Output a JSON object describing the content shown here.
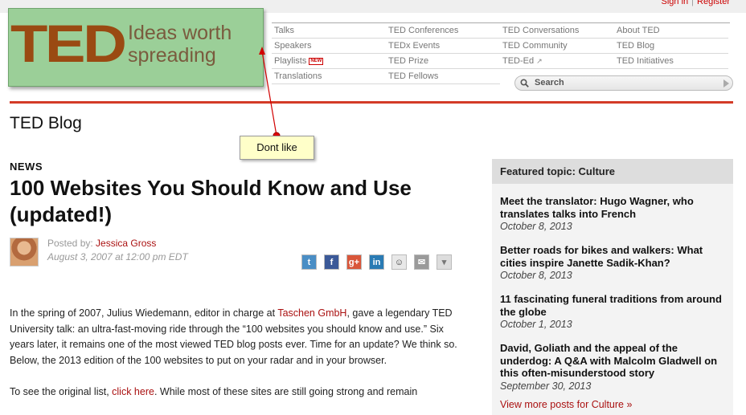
{
  "auth": {
    "sign_in": "Sign in",
    "register": "Register"
  },
  "logo": {
    "wordmark": "TED",
    "tagline_line1": "Ideas worth",
    "tagline_line2": "spreading"
  },
  "nav": {
    "columns": [
      [
        {
          "label": "Talks"
        },
        {
          "label": "Speakers"
        },
        {
          "label": "Playlists",
          "badge": "NEW"
        },
        {
          "label": "Translations"
        }
      ],
      [
        {
          "label": "TED Conferences"
        },
        {
          "label": "TEDx Events"
        },
        {
          "label": "TED Prize"
        },
        {
          "label": "TED Fellows"
        }
      ],
      [
        {
          "label": "TED Conversations"
        },
        {
          "label": "TED Community"
        },
        {
          "label": "TED-Ed"
        }
      ],
      [
        {
          "label": "About TED"
        },
        {
          "label": "TED Blog"
        },
        {
          "label": "TED Initiatives"
        }
      ]
    ]
  },
  "search": {
    "label": "Search"
  },
  "blog_title": "TED Blog",
  "note": {
    "text": "Dont like"
  },
  "article": {
    "category": "NEWS",
    "headline": "100 Websites You Should Know and Use (updated!)",
    "posted_by_prefix": "Posted by:",
    "author": "Jessica Gross",
    "date": "August 3, 2007 at 12:00 pm EDT",
    "p1_a": "In the spring of 2007, Julius Wiedemann, editor in charge at ",
    "p1_link": "Taschen GmbH",
    "p1_b": ", gave a legendary TED University talk: an ultra-fast-moving ride through the “100 websites you should know and use.” Six years later, it remains one of the most viewed TED blog posts ever. Time for an update? We think so. Below, the 2013 edition of the 100 websites to put on your radar and in your browser.",
    "p2_a": "To see the original list, ",
    "p2_link": "click here",
    "p2_b": ". While most of these sites are still going strong and remain"
  },
  "share": [
    "twitter-icon",
    "facebook-icon",
    "google-plus-icon",
    "linkedin-icon",
    "reddit-icon",
    "email-icon",
    "more-icon"
  ],
  "sidebar": {
    "heading": "Featured topic: Culture",
    "items": [
      {
        "title": "Meet the translator: Hugo Wagner, who translates talks into French",
        "date": "October 8, 2013"
      },
      {
        "title": "Better roads for bikes and walkers: What cities inspire Janette Sadik-Khan?",
        "date": "October 8, 2013"
      },
      {
        "title": "11 fascinating funeral traditions from around the globe",
        "date": "October 1, 2013"
      },
      {
        "title": "David, Goliath and the appeal of the underdog: A Q&A with Malcolm Gladwell on this often-misunderstood story",
        "date": "September 30, 2013"
      }
    ],
    "more": "View more posts for Culture »"
  },
  "colors": {
    "accent_red": "#d33b27",
    "link_red": "#aa1111",
    "note_yellow": "#ffffc9",
    "logo_green": "#9bcf98"
  }
}
